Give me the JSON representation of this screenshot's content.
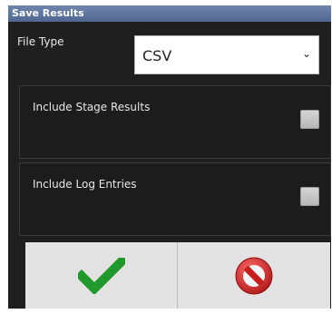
{
  "dialog": {
    "title": "Save Results",
    "file_type_label": "File Type",
    "file_type_value": "CSV",
    "options": [
      {
        "label": "Include Stage Results",
        "checked": false
      },
      {
        "label": "Include Log Entries",
        "checked": false
      }
    ],
    "buttons": {
      "ok_icon": "checkmark-icon",
      "cancel_icon": "no-entry-icon"
    },
    "colors": {
      "title_bar": "#5b72a0",
      "background": "#1f1f1f",
      "ok_green": "#1f9a2a",
      "cancel_red": "#d22a2a"
    }
  }
}
